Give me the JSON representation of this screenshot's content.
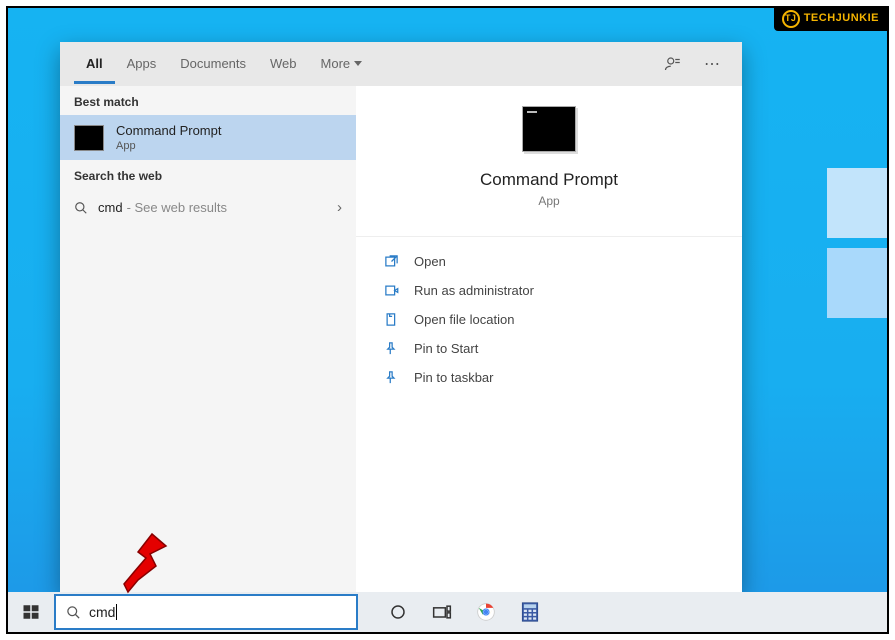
{
  "watermark": "TECHJUNKIE",
  "tabs": {
    "all": "All",
    "apps": "Apps",
    "documents": "Documents",
    "web": "Web",
    "more": "More"
  },
  "left": {
    "best_match_label": "Best match",
    "best_match_title": "Command Prompt",
    "best_match_sub": "App",
    "search_web_label": "Search the web",
    "web_query": "cmd",
    "web_hint": "- See web results"
  },
  "right": {
    "title": "Command Prompt",
    "sub": "App",
    "actions": {
      "open": "Open",
      "run_admin": "Run as administrator",
      "open_loc": "Open file location",
      "pin_start": "Pin to Start",
      "pin_taskbar": "Pin to taskbar"
    }
  },
  "search_value": "cmd"
}
